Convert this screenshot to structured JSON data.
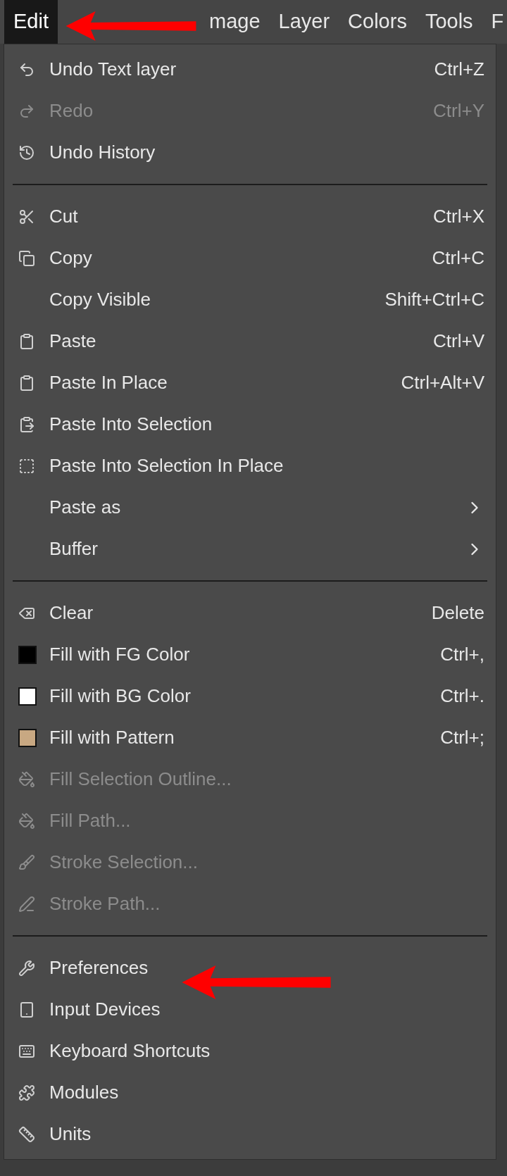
{
  "menubar": [
    {
      "label": "Edit",
      "selected": true
    },
    {
      "kind": "covered"
    },
    {
      "label": "mage",
      "selected": false
    },
    {
      "label": "Layer",
      "selected": false
    },
    {
      "label": "Colors",
      "selected": false
    },
    {
      "label": "Tools",
      "selected": false
    },
    {
      "label": "F",
      "selected": false
    }
  ],
  "menu": {
    "sections": [
      {
        "items": [
          {
            "label": "Undo Text layer",
            "shortcut": "Ctrl+Z",
            "disabled": false
          },
          {
            "label": "Redo",
            "shortcut": "Ctrl+Y",
            "disabled": true
          },
          {
            "label": "Undo History",
            "disabled": false
          }
        ]
      },
      {
        "items": [
          {
            "label": "Cut",
            "shortcut": "Ctrl+X",
            "disabled": false
          },
          {
            "label": "Copy",
            "shortcut": "Ctrl+C",
            "disabled": false
          },
          {
            "label": "Copy Visible",
            "shortcut": "Shift+Ctrl+C",
            "disabled": false
          },
          {
            "label": "Paste",
            "shortcut": "Ctrl+V",
            "disabled": false
          },
          {
            "label": "Paste In Place",
            "shortcut": "Ctrl+Alt+V",
            "disabled": false
          },
          {
            "label": "Paste Into Selection",
            "disabled": false
          },
          {
            "label": "Paste Into Selection In Place",
            "disabled": false
          },
          {
            "label": "Paste as",
            "submenu": true,
            "disabled": false
          },
          {
            "label": "Buffer",
            "submenu": true,
            "disabled": false
          }
        ]
      },
      {
        "items": [
          {
            "label": "Clear",
            "shortcut": "Delete",
            "disabled": false
          },
          {
            "label": "Fill with FG Color",
            "shortcut": "Ctrl+,",
            "color": "#000000",
            "disabled": false
          },
          {
            "label": "Fill with BG Color",
            "shortcut": "Ctrl+.",
            "color": "#ffffff",
            "disabled": false
          },
          {
            "label": "Fill with Pattern",
            "shortcut": "Ctrl+;",
            "color": "#c8a882",
            "disabled": false
          },
          {
            "label": "Fill Selection Outline...",
            "disabled": true
          },
          {
            "label": "Fill Path...",
            "disabled": true
          },
          {
            "label": "Stroke Selection...",
            "disabled": true
          },
          {
            "label": "Stroke Path...",
            "disabled": true
          }
        ]
      },
      {
        "items": [
          {
            "label": "Preferences",
            "disabled": false
          },
          {
            "label": "Input Devices",
            "disabled": false
          },
          {
            "label": "Keyboard Shortcuts",
            "disabled": false
          },
          {
            "label": "Modules",
            "disabled": false
          },
          {
            "label": "Units",
            "disabled": false
          }
        ]
      }
    ]
  }
}
